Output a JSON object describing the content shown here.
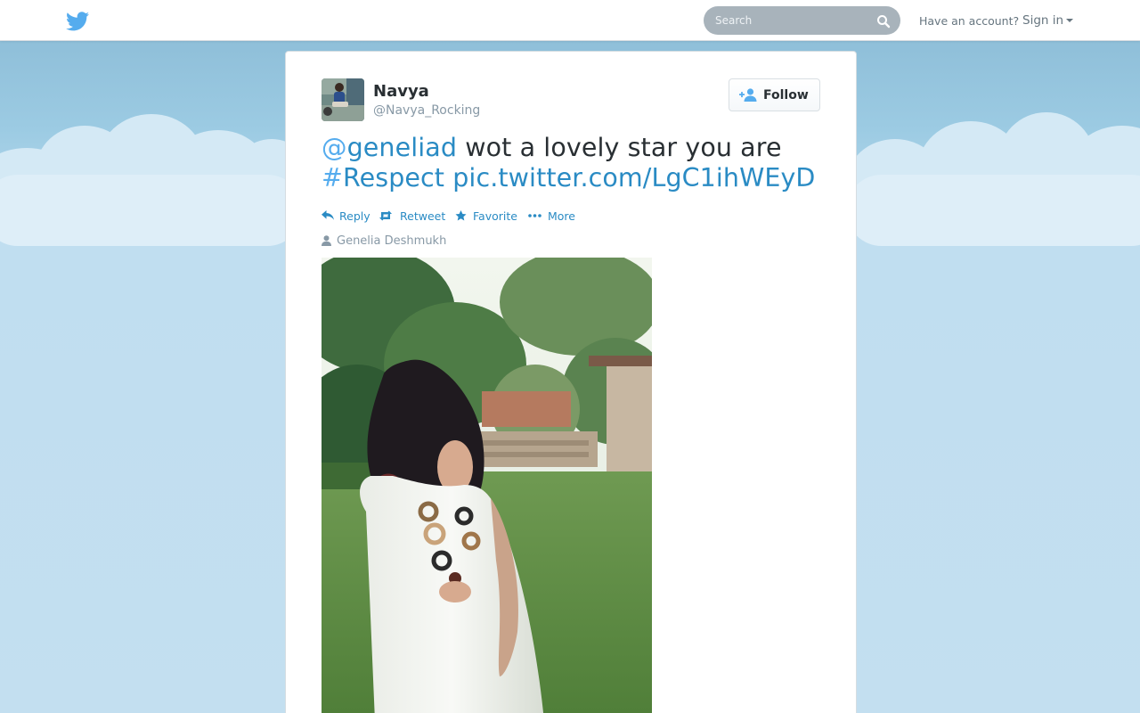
{
  "topbar": {
    "logo_icon": "twitter-bird-icon",
    "search_placeholder": "Search",
    "search_icon": "magnifier-icon",
    "have_account": "Have an account?",
    "signin_label": "Sign in"
  },
  "tweet": {
    "fullname": "Navya",
    "username": "@Navya_Rocking",
    "follow_label": "Follow",
    "text": {
      "mention_symbol": "@",
      "mention": "geneliad",
      "body": " wot a lovely star you are",
      "hashtag_symbol": "#",
      "hashtag": "Respect",
      "link": "pic.twitter.com/LgC1ihWEyD"
    },
    "actions": {
      "reply": "Reply",
      "retweet": "Retweet",
      "favorite": "Favorite",
      "more": "More"
    },
    "mention_context": "Genelia Deshmukh"
  },
  "colors": {
    "link": "#2a8bc4",
    "brand": "#55acee",
    "text": "#292f33",
    "muted": "#8899a6"
  }
}
